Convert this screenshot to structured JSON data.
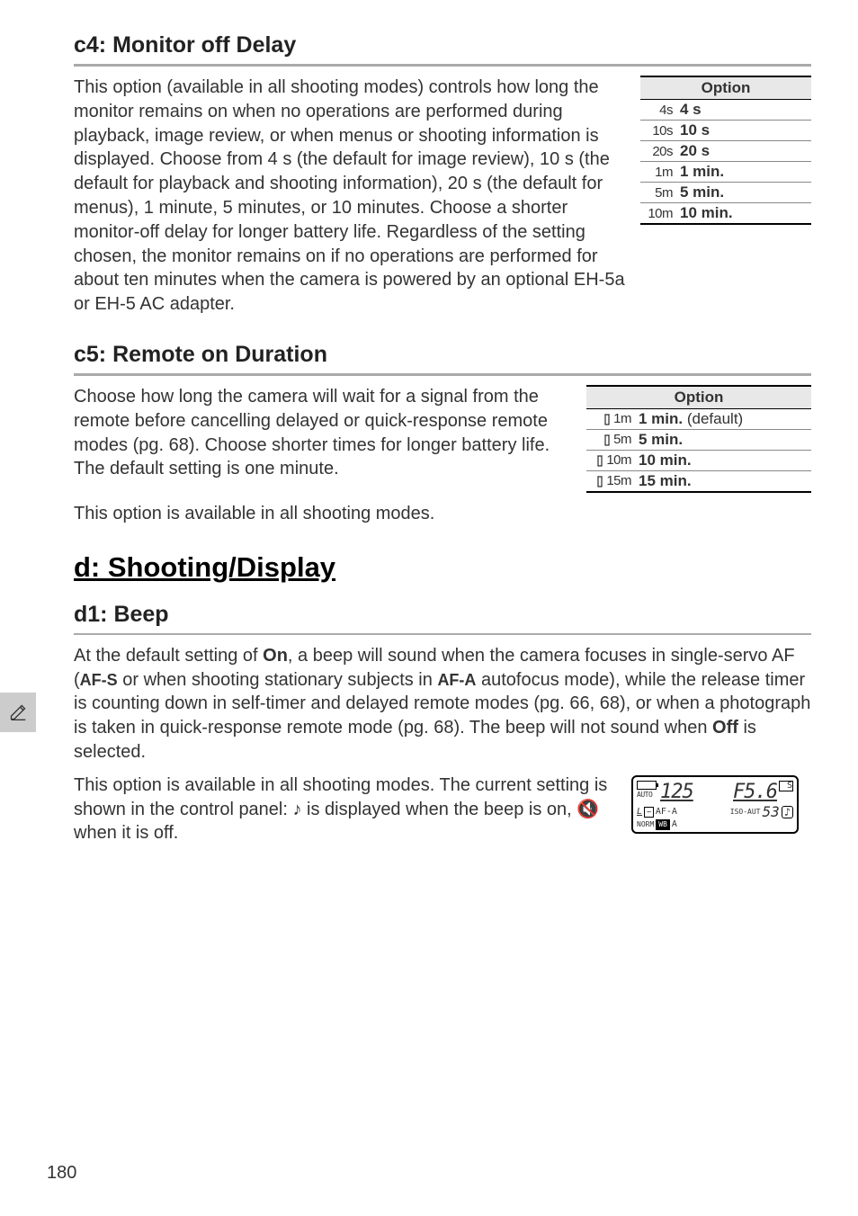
{
  "c4": {
    "heading": "c4: Monitor off Delay",
    "body": "This option (available in all shooting modes) controls how long the monitor remains on when no operations are performed during playback, image review, or when menus or shooting information is displayed.  Choose from 4 s (the default for image review), 10 s (the default for playback and shooting information), 20 s (the default for menus), 1 minute, 5 minutes, or 10 minutes.  Choose a shorter monitor-off delay for longer battery life.  Regardless of the setting chosen, the monitor remains on if no operations are performed for about ten minutes when the camera is powered by an optional EH-5a or EH-5 AC adapter.",
    "table": {
      "header": "Option",
      "rows": [
        {
          "sym": "4s",
          "label": "4 s"
        },
        {
          "sym": "10s",
          "label": "10 s"
        },
        {
          "sym": "20s",
          "label": "20 s"
        },
        {
          "sym": "1m",
          "label": "1 min."
        },
        {
          "sym": "5m",
          "label": "5 min."
        },
        {
          "sym": "10m",
          "label": "10 min."
        }
      ]
    }
  },
  "c5": {
    "heading": "c5: Remote on Duration",
    "body": "Choose how long the camera will wait for a signal from the remote before cancelling delayed or quick-response remote modes (pg. 68).  Choose shorter times for longer battery life.  The default setting is one minute.",
    "foot": "This option is available in all shooting modes.",
    "table": {
      "header": "Option",
      "rows": [
        {
          "sym": "1m",
          "label": "1 min.",
          "extra": " (default)"
        },
        {
          "sym": "5m",
          "label": "5 min.",
          "extra": ""
        },
        {
          "sym": "10m",
          "label": "10 min.",
          "extra": ""
        },
        {
          "sym": "15m",
          "label": "15 min.",
          "extra": ""
        }
      ]
    }
  },
  "d": {
    "heading": "d: Shooting/Display"
  },
  "d1": {
    "heading": "d1: Beep",
    "para1_pre": "At the default setting of ",
    "para1_on": "On",
    "para1_mid1": ", a beep will sound when the camera focuses in single-servo AF (",
    "afs": "AF-S",
    "para1_mid2": " or when shooting stationary subjects in ",
    "afa": "AF-A",
    "para1_mid3": " autofocus mode), while the release timer is counting down in self-timer and delayed remote modes (pg. 66, 68), or when a photograph is taken in quick-response remote mode (pg. 68).  The beep will not sound when ",
    "off": "Off",
    "para1_end": " is selected.",
    "para2_pre": "This option is available in all shooting modes.  The current setting is shown in the control panel: ",
    "beep_icon": "♪",
    "para2_mid": " is displayed when the beep is on, ",
    "mute_icon": "🔇",
    "para2_end": " when it is off."
  },
  "lcd": {
    "shutter": "125",
    "aperture": "F5.6",
    "s_icon": "S",
    "auto": "AUTO",
    "l": "L",
    "afa": "AF-A",
    "iso": "ISO-AUT",
    "count": "53",
    "note": "♪",
    "norm": "NORM",
    "wb": "WB",
    "a": "A"
  },
  "page_number": "180"
}
